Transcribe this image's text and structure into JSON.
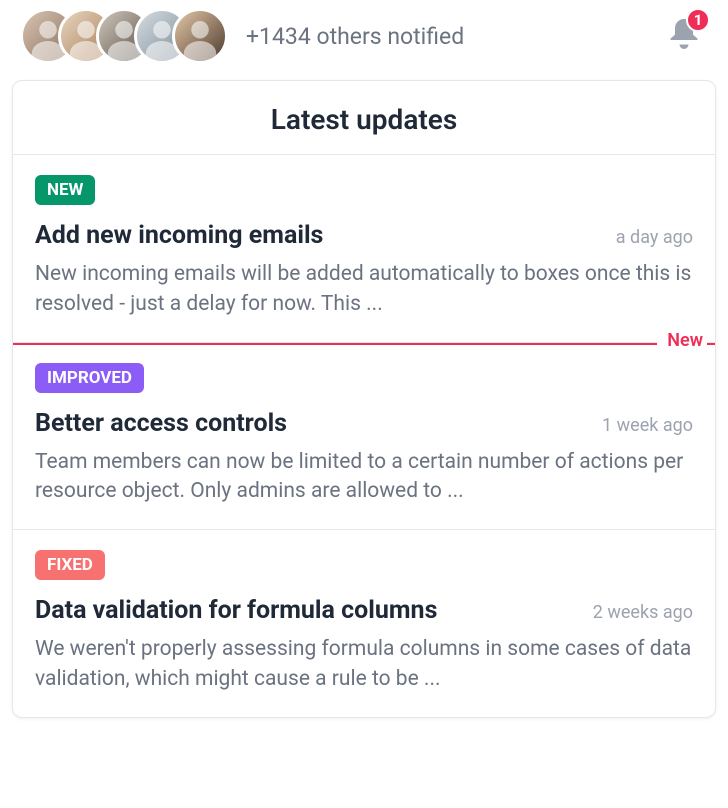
{
  "header": {
    "avatars": [
      "user-1",
      "user-2",
      "user-3",
      "user-4",
      "user-5"
    ],
    "others_text": "+1434 others notified",
    "bell_badge": "1"
  },
  "card": {
    "title": "Latest updates",
    "new_divider_label": "New",
    "entries": [
      {
        "tag": "NEW",
        "tag_kind": "new",
        "title": "Add new incoming emails",
        "time": "a day ago",
        "body": "New incoming emails will be added automatically to boxes once this is resolved - just a delay for now.  This ..."
      },
      {
        "tag": "IMPROVED",
        "tag_kind": "improved",
        "title": "Better access controls",
        "time": "1 week ago",
        "body": "Team members can now be limited to a certain number of actions per resource object. Only admins are allowed to ..."
      },
      {
        "tag": "FIXED",
        "tag_kind": "fixed",
        "title": "Data validation for formula columns",
        "time": "2 weeks ago",
        "body": "We weren't properly assessing formula columns in some cases of data validation, which might cause a rule to be ..."
      }
    ]
  }
}
